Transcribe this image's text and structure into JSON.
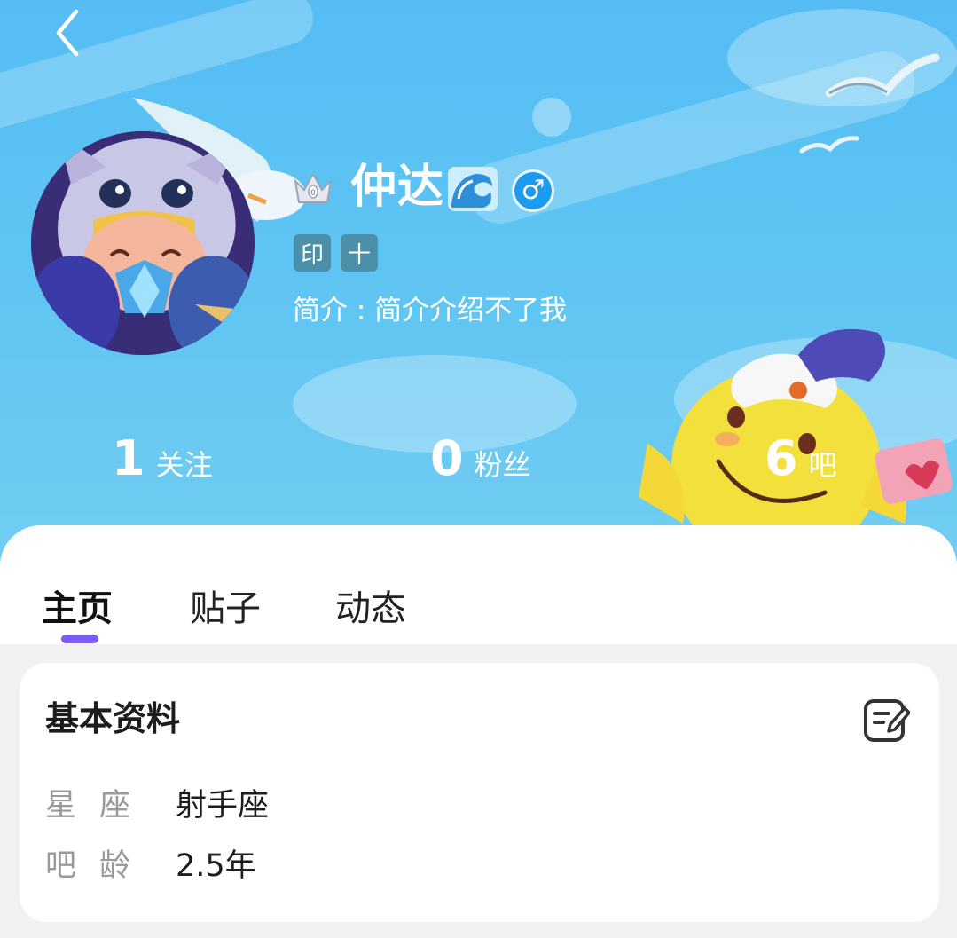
{
  "nav": {
    "back_icon": "chevron-left-icon"
  },
  "profile": {
    "username": "仲达",
    "crown_icon": "crown-icon",
    "name_emoji_icon": "wave-icon",
    "gender_icon": "male-icon",
    "gender_symbol": "♂",
    "badges": [
      "印",
      "十"
    ],
    "bio": "简介 : 简介介绍不了我"
  },
  "stats": [
    {
      "value": "1",
      "label": "关注"
    },
    {
      "value": "0",
      "label": "粉丝"
    },
    {
      "value": "6",
      "label": "吧"
    }
  ],
  "tabs": [
    {
      "label": "主页",
      "active": true
    },
    {
      "label": "贴子",
      "active": false
    },
    {
      "label": "动态",
      "active": false
    }
  ],
  "basic_info": {
    "title": "基本资料",
    "edit_icon": "edit-icon",
    "rows": [
      {
        "label": "星座",
        "value": "射手座"
      },
      {
        "label": "吧龄",
        "value": "2.5年"
      }
    ]
  },
  "colors": {
    "banner_blue": "#5ec4f3",
    "tab_indicator": "#7b5cf6",
    "gender_blue": "#1a9bf0",
    "badge_bg": "#4b8fa8"
  }
}
